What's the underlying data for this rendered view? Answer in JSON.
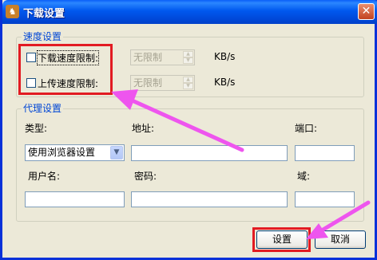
{
  "window": {
    "title": "下载设置",
    "app_icon": "app-icon",
    "close_glyph": "✕"
  },
  "speed": {
    "group_label": "速度设置",
    "download_limit": {
      "label": "下载速度限制:",
      "checked": false,
      "value": "无限制",
      "unit": "KB/s"
    },
    "upload_limit": {
      "label": "上传速度限制:",
      "checked": false,
      "value": "无限制",
      "unit": "KB/s"
    }
  },
  "proxy": {
    "group_label": "代理设置",
    "type_label": "类型:",
    "type_value": "使用浏览器设置",
    "address_label": "地址:",
    "address_value": "",
    "port_label": "端口:",
    "port_value": "",
    "username_label": "用户名:",
    "username_value": "",
    "password_label": "密码:",
    "password_value": "",
    "domain_label": "域:",
    "domain_value": ""
  },
  "buttons": {
    "settings": "设置",
    "cancel": "取消"
  },
  "annotation_color": "#e21b22",
  "arrow_color": "#ee55ee"
}
